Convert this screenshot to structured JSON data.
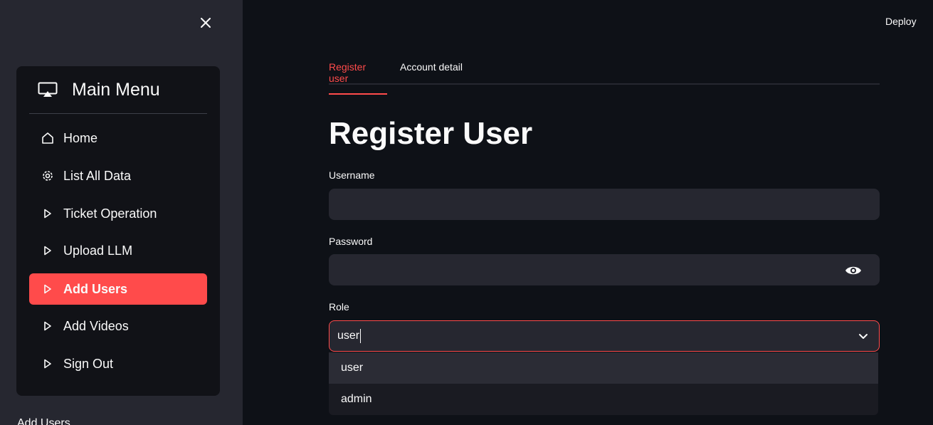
{
  "sidebar": {
    "menu_title": "Main Menu",
    "items": [
      {
        "label": "Home",
        "icon": "house-icon"
      },
      {
        "label": "List All Data",
        "icon": "gear-icon"
      },
      {
        "label": "Ticket Operation",
        "icon": "play-icon"
      },
      {
        "label": "Upload LLM",
        "icon": "play-icon"
      },
      {
        "label": "Add Users",
        "icon": "play-icon",
        "active": true
      },
      {
        "label": "Add Videos",
        "icon": "play-icon"
      },
      {
        "label": "Sign Out",
        "icon": "play-icon"
      }
    ],
    "footer_text": "Add Users"
  },
  "header": {
    "deploy_label": "Deploy"
  },
  "tabs": [
    {
      "label": "Register user",
      "active": true
    },
    {
      "label": "Account detail",
      "active": false
    }
  ],
  "form": {
    "title": "Register User",
    "username_label": "Username",
    "username_value": "",
    "password_label": "Password",
    "password_value": "",
    "role_label": "Role",
    "role_value": "user",
    "role_options": [
      "user",
      "admin"
    ]
  },
  "colors": {
    "accent": "#ff4b4b",
    "background": "#0e1117",
    "sidebar": "#262730",
    "input": "#262730"
  }
}
